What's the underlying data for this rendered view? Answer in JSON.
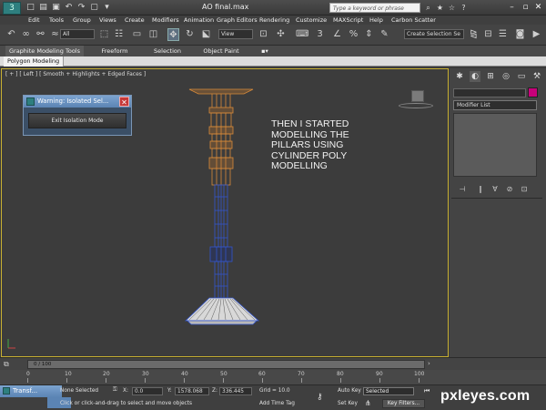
{
  "titlebar": {
    "title": "AO final.max",
    "search_placeholder": "Type a keyword or phrase"
  },
  "menu": [
    "Edit",
    "Tools",
    "Group",
    "Views",
    "Create",
    "Modifiers",
    "Animation",
    "Graph Editors",
    "Rendering",
    "Customize",
    "MAXScript",
    "Help",
    "Carbon Scatter"
  ],
  "toolbar": {
    "selection_filter": "All",
    "reference_coord": "View",
    "named_selection": "Create Selection Se"
  },
  "ribbon": {
    "tabs": [
      "Graphite Modeling Tools",
      "Freeform",
      "Selection",
      "Object Paint"
    ],
    "panel": "Polygon Modeling"
  },
  "viewport": {
    "label": "[ + ] [ Left ] [ Smooth + Highlights + Edged Faces ]",
    "annotation_lines": [
      "THEN I STARTED",
      "MODELLING THE",
      "PILLARS USING",
      "CYLINDER POLY",
      "MODELLING"
    ]
  },
  "isolate_dialog": {
    "title": "Warning: Isolated Sel...",
    "button": "Exit Isolation Mode"
  },
  "command_panel": {
    "modifier_list": "Modifier List",
    "object_color": "#c8007a"
  },
  "timeline": {
    "position": "0 / 100",
    "ruler_labels": [
      "0",
      "10",
      "20",
      "30",
      "40",
      "50",
      "60",
      "70",
      "80",
      "90",
      "100"
    ]
  },
  "status": {
    "transform_tab": "Transf...",
    "selection": "None Selected",
    "prompt": "Click or click-and-drag to select and move objects",
    "x_label": "X:",
    "x_value": "0.0",
    "y_label": "Y:",
    "y_value": "1578.068",
    "z_label": "Z:",
    "z_value": "336.445",
    "grid": "Grid = 10.0",
    "add_time_tag": "Add Time Tag",
    "auto_key": "Auto Key",
    "auto_key_mode": "Selected",
    "set_key": "Set Key",
    "key_filters": "Key Filters..."
  },
  "watermark": "pxleyes.com"
}
